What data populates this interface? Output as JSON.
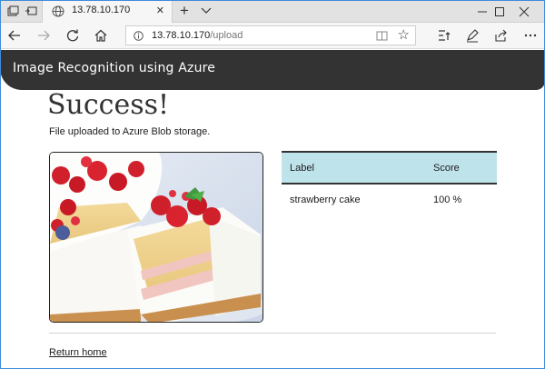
{
  "browser": {
    "tab_title": "13.78.10.170",
    "tab_close": "✕",
    "new_tab": "+",
    "url_host": "13.78.10.170",
    "url_path": "/upload",
    "star": "☆"
  },
  "app": {
    "title": "Image Recognition using Azure"
  },
  "main": {
    "heading": "Success!",
    "message": "File uploaded to Azure Blob storage.",
    "table": {
      "headers": [
        "Label",
        "Score"
      ],
      "rows": [
        [
          "strawberry cake",
          "100 %"
        ]
      ]
    },
    "home_link": "Return home"
  }
}
